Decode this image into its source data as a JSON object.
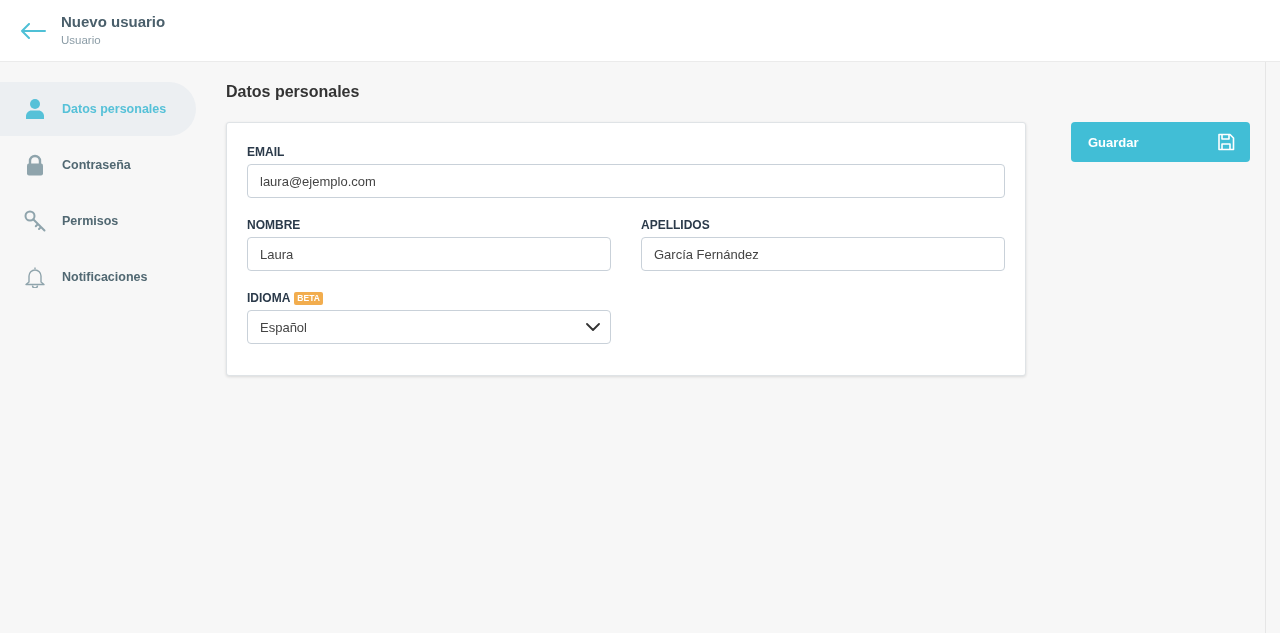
{
  "header": {
    "title": "Nuevo usuario",
    "subtitle": "Usuario"
  },
  "sidebar": {
    "items": [
      {
        "label": "Datos personales",
        "selected": true
      },
      {
        "label": "Contraseña",
        "selected": false
      },
      {
        "label": "Permisos",
        "selected": false
      },
      {
        "label": "Notificaciones",
        "selected": false
      }
    ]
  },
  "section": {
    "title": "Datos personales"
  },
  "form": {
    "email": {
      "label": "EMAIL",
      "value": "laura@ejemplo.com"
    },
    "names": [
      {
        "label": "NOMBRE",
        "value": "Laura"
      },
      {
        "label": "APELLIDOS",
        "value": "García Fernández"
      }
    ],
    "language": {
      "label": "IDIOMA",
      "badge": "BETA",
      "value": "Español"
    }
  },
  "save_button": {
    "label": "Guardar"
  }
}
